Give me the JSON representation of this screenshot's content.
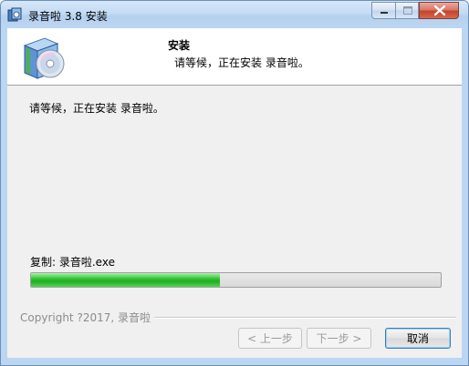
{
  "window": {
    "title": "录音啦 3.8 安装",
    "controls": {
      "minimize": "minimize",
      "maximize": "maximize",
      "close": "close"
    }
  },
  "header": {
    "title": "安装",
    "subtitle": "请等候，正在安装 录音啦。"
  },
  "body": {
    "status": "请等候，正在安装 录音啦。",
    "detail": "复制: 录音啦.exe",
    "progress": 0.46
  },
  "footer": {
    "copyright": "Copyright ?2017, 录音啦",
    "back_label": "< 上一步",
    "next_label": "下一步 >",
    "cancel_label": "取消"
  },
  "colors": {
    "titlebar": "#bcd6f1",
    "progress_fill": "#36c436",
    "close_button": "#c4432c"
  }
}
